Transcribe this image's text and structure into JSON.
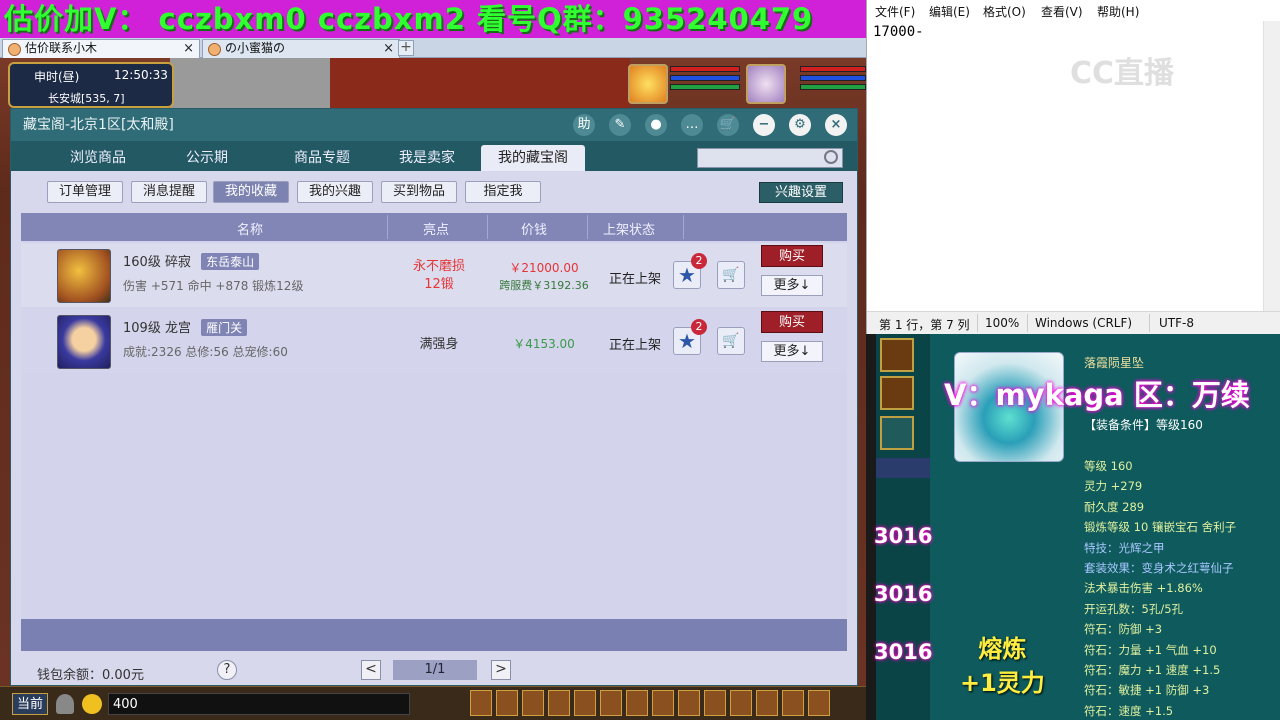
{
  "banner": {
    "text": "估价加V：  cczbxm0   cczbxm2   看号Q群：935240479"
  },
  "browser_tabs": [
    {
      "label": "估价联系小木",
      "close": "×"
    },
    {
      "label": "の小蜜猫の",
      "close": "×"
    }
  ],
  "browser_new_tab": "+",
  "hud": {
    "time_label": "申时(昼)",
    "clock": "12:50:33",
    "location": "长安城[535, 7]"
  },
  "cbg": {
    "title": "藏宝阁-北京1区[太和殿]",
    "tools": [
      "助",
      "✎",
      "●",
      "…",
      "🛒",
      "−",
      "⚙",
      "×"
    ],
    "nav_tabs": [
      "浏览商品",
      "公示期",
      "商品专题",
      "我是卖家",
      "我的藏宝阁"
    ],
    "sub_buttons": [
      "订单管理",
      "消息提醒",
      "我的收藏",
      "我的兴趣",
      "买到物品",
      "指定我"
    ],
    "interest_settings": "兴趣设置",
    "columns": {
      "name": "名称",
      "highlight": "亮点",
      "price": "价钱",
      "status": "上架状态"
    },
    "rows": [
      {
        "level_name": "160级  碎寂",
        "tag": "东岳泰山",
        "attrs": "伤害 +571  命中 +878  锻炼12级",
        "highlight1": "永不磨损",
        "highlight2": "12锻",
        "price": "￥21000.00",
        "fee": "跨服费￥3192.36",
        "status": "正在上架",
        "fav_count": "2",
        "buy": "购买",
        "more": "更多↓"
      },
      {
        "level_name": "109级  龙宫",
        "tag": "雁门关",
        "attrs": "成就:2326  总修:56  总宠修:60",
        "highlight1": "满强身",
        "highlight2": "",
        "price": "￥4153.00",
        "fee": "",
        "status": "正在上架",
        "fav_count": "2",
        "buy": "购买",
        "more": "更多↓"
      }
    ],
    "wallet": "钱包余额：0.00元",
    "help": "?",
    "page_prev": "<",
    "page_indicator": "1/1",
    "page_next": ">"
  },
  "gamebar": {
    "chat_channel": "当前",
    "chat_input": "400"
  },
  "notepad": {
    "menu": [
      "文件(F)",
      "编辑(E)",
      "格式(O)",
      "查看(V)",
      "帮助(H)"
    ],
    "content": "17000-",
    "status_pos": "第 1 行，第 7 列",
    "status_zoom": "100%",
    "status_eol": "Windows (CRLF)",
    "status_enc": "UTF-8"
  },
  "watermark": "CC直播",
  "side_numbers": [
    "3016",
    "3016",
    "3016"
  ],
  "equip": {
    "name": "落霞陨星坠",
    "contact_overlay": "V：mykaga  区：万续",
    "requirement": "【装备条件】等级160",
    "stats": [
      "等级 160",
      "灵力 +279",
      "耐久度 289",
      "锻炼等级 10  镶嵌宝石 舍利子",
      "特技：光辉之甲",
      "套装效果：变身术之红萼仙子",
      "法术暴击伤害 +1.86%",
      "开运孔数：5孔/5孔",
      "符石：防御 +3",
      "符石：力量 +1  气血 +10",
      "符石：魔力 +1  速度 +1.5",
      "符石：敏捷 +1  防御 +3",
      "符石：速度 +1.5"
    ],
    "smelt_line1": "熔炼",
    "smelt_line2": "+1灵力"
  }
}
